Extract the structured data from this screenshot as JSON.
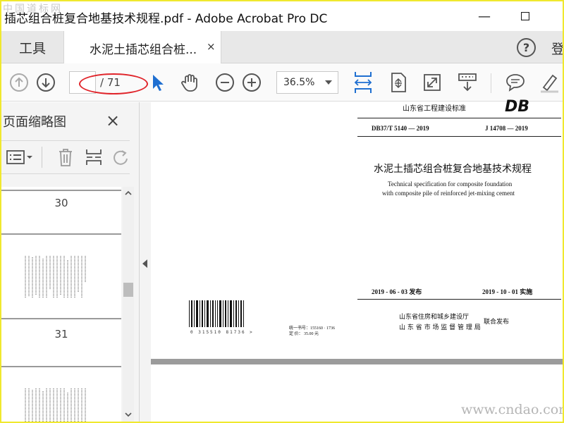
{
  "window": {
    "title": "插芯组合桩复合地基技术规程.pdf - Adobe Acrobat Pro DC",
    "minimize_glyph": "—",
    "maximize_glyph": "☐"
  },
  "watermark_top": "中国道标网",
  "watermark_bottom": "www.cndao.com",
  "tabs": {
    "tools_label": "工具",
    "doc_label": "水泥土插芯组合桩...",
    "doc_close": "×",
    "help_label": "?",
    "signin_label": "登"
  },
  "toolbar": {
    "page_current": "",
    "page_total": "/ 71",
    "zoom": "36.5%",
    "icons": [
      "prev-page-icon",
      "next-page-icon",
      "select-cursor-icon",
      "hand-tool-icon",
      "zoom-out-icon",
      "zoom-in-icon",
      "fit-page-icon",
      "scroll-mode-icon",
      "full-screen-icon",
      "read-mode-icon",
      "comment-icon",
      "highlight-icon"
    ]
  },
  "left_pane": {
    "title": "页面缩略图",
    "close": "×",
    "thumbnails": [
      {
        "number": "30"
      },
      {
        "number": "31"
      }
    ]
  },
  "document": {
    "header_standard": "山东省工程建设标准",
    "logo": "DB",
    "code_left": "DB37/T 5140 — 2019",
    "code_right": "J 14708 — 2019",
    "title_cn": "水泥土插芯组合桩复合地基技术规程",
    "title_en_1": "Technical specification for composite foundation",
    "title_en_2": "with composite pile of reinforced jet-mixing cement",
    "publish_date": "2019 - 06 - 03  发布",
    "effective_date": "2019 - 10 - 01  实施",
    "issuer_1": "山东省住房和城乡建设厅",
    "issuer_2": "山 东 省 市 场 监 督 管 理 局",
    "issue_joint": "联合发布",
    "book_number": "统一书号：155160 · 1736",
    "price": "定    价：  35.00  元",
    "barcode_digits": "0 315510 81736 >"
  }
}
